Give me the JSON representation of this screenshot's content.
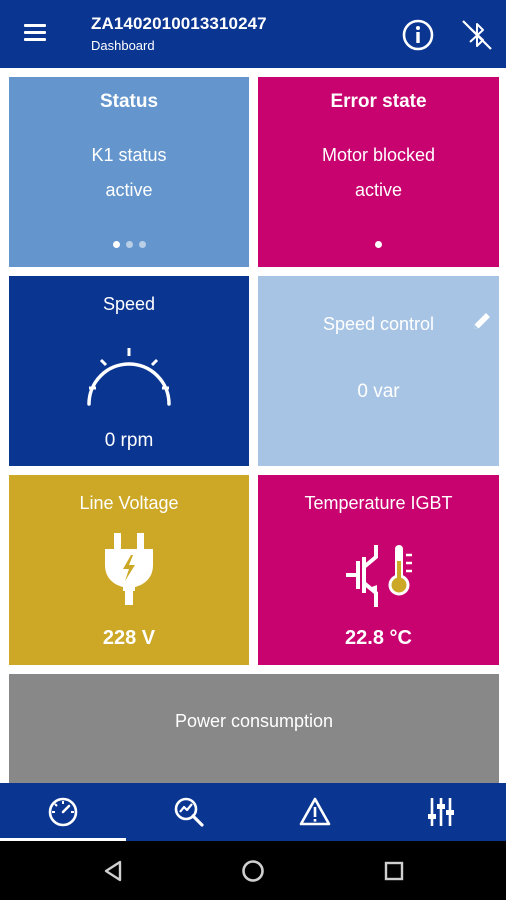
{
  "header": {
    "title": "ZA1402010013310247",
    "subtitle": "Dashboard",
    "icons": [
      "menu-icon",
      "info-icon",
      "bluetooth-disabled-icon"
    ]
  },
  "tiles": {
    "status": {
      "title": "Status",
      "line1": "K1 status",
      "line2": "active",
      "page_count": 3,
      "active_page": 1,
      "color": "#6496cd"
    },
    "error": {
      "title": "Error state",
      "line1": "Motor blocked",
      "line2": "active",
      "page_count": 1,
      "active_page": 1,
      "color": "#c8026e"
    },
    "speed": {
      "title": "Speed",
      "value": "0 rpm",
      "icon": "speedometer-icon",
      "color": "#0a3591"
    },
    "speed_control": {
      "title": "Speed control",
      "value": "0 var",
      "icon": "pencil-icon",
      "color": "#a7c4e4"
    },
    "line_voltage": {
      "title": "Line Voltage",
      "value": "228 V",
      "icon": "power-plug-icon",
      "color": "#cca826"
    },
    "temperature": {
      "title": "Temperature IGBT",
      "value": "22.8 °C",
      "icon": "igbt-thermometer-icon",
      "color": "#c8026e"
    },
    "power": {
      "title": "Power consumption",
      "color": "#888888"
    }
  },
  "bottom_nav": {
    "items": [
      {
        "id": "dashboard",
        "icon": "gauge-icon",
        "selected": true
      },
      {
        "id": "analysis",
        "icon": "search-chart-icon",
        "selected": false
      },
      {
        "id": "warnings",
        "icon": "warning-icon",
        "selected": false
      },
      {
        "id": "settings",
        "icon": "sliders-icon",
        "selected": false
      }
    ]
  },
  "system_nav": {
    "icons": [
      "back-icon",
      "home-icon",
      "recents-icon"
    ]
  },
  "colors": {
    "primary": "#0a3591",
    "magenta": "#c8026e",
    "light_blue": "#6496cd",
    "pale_blue": "#a7c4e4",
    "yellow": "#cca826",
    "grey": "#888888"
  }
}
